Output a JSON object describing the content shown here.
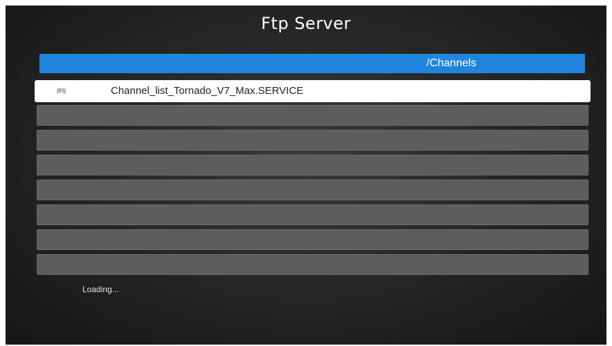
{
  "header": {
    "title": "Ftp Server"
  },
  "path_bar": {
    "path": "/Channels"
  },
  "file_list": {
    "items": [
      {
        "name": "Channel_list_Tornado_V7_Max.SERVICE",
        "icon": "gamepad-icon",
        "selected": true
      },
      {
        "name": "",
        "selected": false
      },
      {
        "name": "",
        "selected": false
      },
      {
        "name": "",
        "selected": false
      },
      {
        "name": "",
        "selected": false
      },
      {
        "name": "",
        "selected": false
      },
      {
        "name": "",
        "selected": false
      },
      {
        "name": "",
        "selected": false
      }
    ]
  },
  "status": {
    "text": "Loading..."
  },
  "colors": {
    "path_bar": "#2185de",
    "row_empty": "#5d5d5d",
    "row_selected": "#ffffff"
  }
}
